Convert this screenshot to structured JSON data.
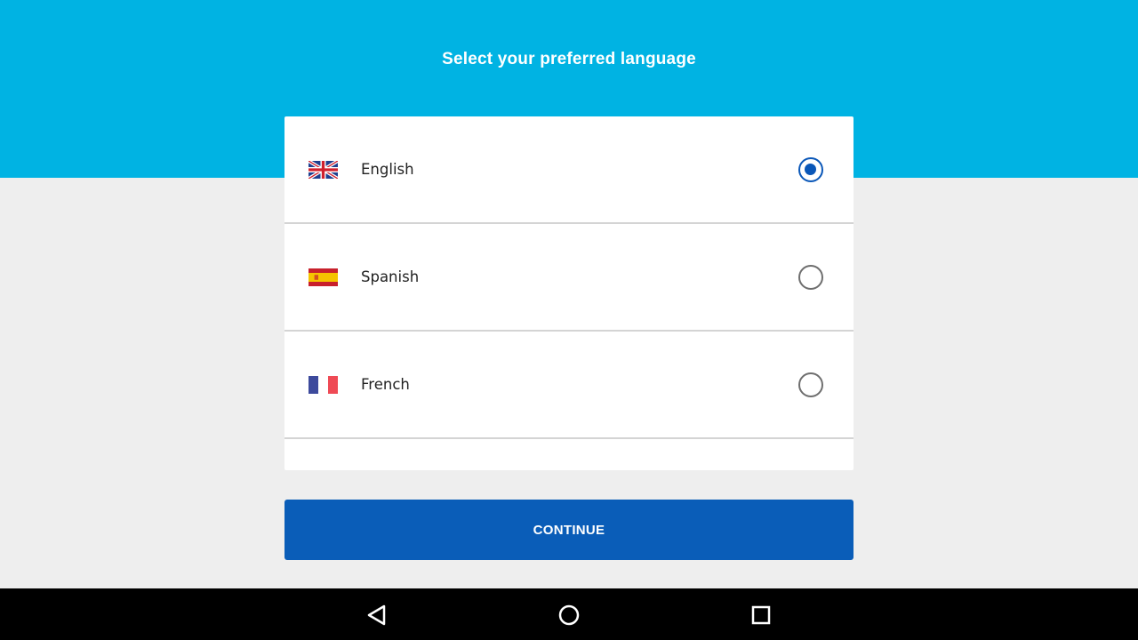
{
  "header": {
    "title": "Select your preferred language"
  },
  "languages": [
    {
      "label": "English",
      "flag_icon": "uk-flag-icon",
      "selected": true
    },
    {
      "label": "Spanish",
      "flag_icon": "spain-flag-icon",
      "selected": false
    },
    {
      "label": "French",
      "flag_icon": "france-flag-icon",
      "selected": false
    }
  ],
  "actions": {
    "continue_label": "CONTINUE"
  },
  "nav_bar": {
    "back_icon": "back-triangle-icon",
    "home_icon": "home-circle-icon",
    "recents_icon": "recents-square-icon"
  },
  "colors": {
    "header_bg": "#00b3e3",
    "page_bg": "#eeeeee",
    "accent": "#0a57b8",
    "button_bg": "#0a5db8"
  }
}
